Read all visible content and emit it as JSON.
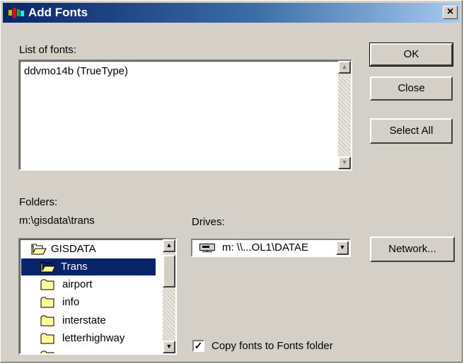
{
  "window": {
    "title": "Add Fonts",
    "close_symbol": "×"
  },
  "list_of_fonts": {
    "label": "List of fonts:",
    "items": [
      "ddvmo14b (TrueType)"
    ]
  },
  "buttons": {
    "ok": "OK",
    "close": "Close",
    "select_all": "Select All",
    "network": "Network..."
  },
  "folders": {
    "label": "Folders:",
    "current_path": "m:\\gisdata\\trans",
    "items": [
      {
        "label": "GISDATA",
        "icon": "open-folder-icon"
      },
      {
        "label": "Trans",
        "icon": "open-folder-icon",
        "selected": true
      },
      {
        "label": "airport",
        "icon": "folder-icon"
      },
      {
        "label": "info",
        "icon": "folder-icon"
      },
      {
        "label": "interstate",
        "icon": "folder-icon"
      },
      {
        "label": "letterhighway",
        "icon": "folder-icon"
      }
    ]
  },
  "drives": {
    "label": "Drives:",
    "selected": "m: \\\\...OL1\\DATAE",
    "icon": "network-drive-icon"
  },
  "copy_option": {
    "label": "Copy fonts to Fonts folder",
    "checked": true,
    "check_symbol": "✓"
  },
  "scroll_symbols": {
    "up": "▲",
    "down": "▼"
  },
  "colors": {
    "title_start": "#0a246a",
    "title_end": "#a6caf0",
    "face": "#d4d0c8",
    "selection": "#0a246a"
  }
}
